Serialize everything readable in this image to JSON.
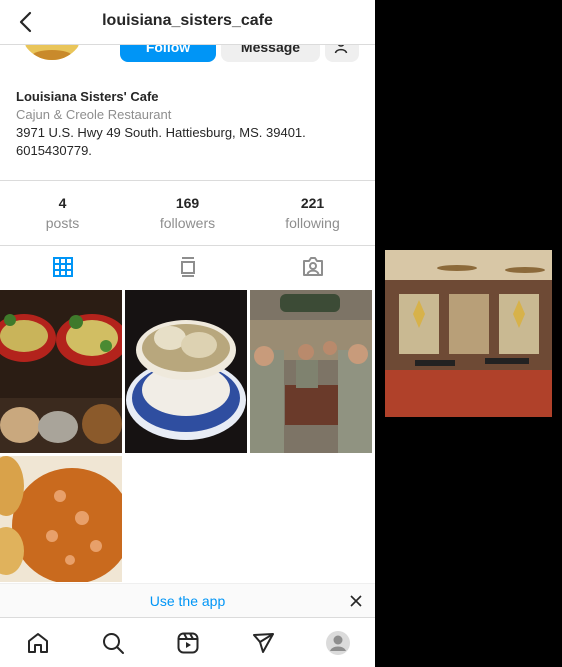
{
  "header": {
    "title": "louisiana_sisters_cafe"
  },
  "actions": {
    "follow_label": "Follow",
    "message_label": "Message"
  },
  "bio": {
    "name": "Louisiana Sisters' Cafe",
    "category": "Cajun & Creole Restaurant",
    "address": "3971 U.S. Hwy 49 South. Hattiesburg, MS. 39401.",
    "phone": "6015430779."
  },
  "stats": [
    {
      "count": "4",
      "label": "posts"
    },
    {
      "count": "169",
      "label": "followers"
    },
    {
      "count": "221",
      "label": "following"
    }
  ],
  "tabs": [
    "grid-icon",
    "reels-feed-icon",
    "tagged-icon"
  ],
  "posts": [
    "crawfish-pasta-platter",
    "dumplings-bowl",
    "soldiers-dining",
    "etouffee-plate"
  ],
  "banner": {
    "use_app": "Use the app"
  },
  "bottom_nav": [
    "home-icon",
    "search-icon",
    "reels-icon",
    "direct-icon",
    "profile-avatar"
  ],
  "colors": {
    "accent": "#0095f6",
    "border": "#dbdbdb",
    "muted": "#8e8e8e"
  }
}
